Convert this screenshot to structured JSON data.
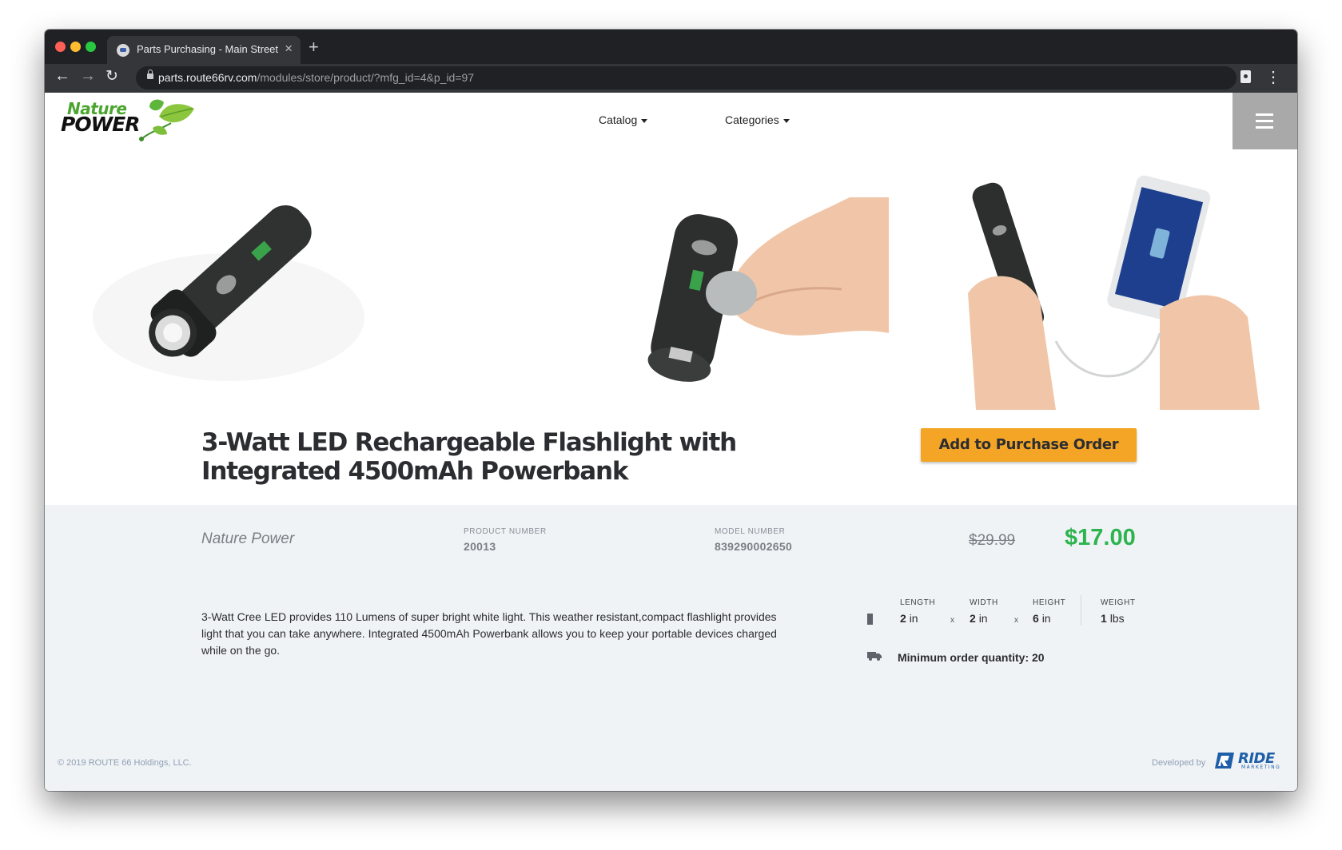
{
  "browser": {
    "tab_title": "Parts Purchasing - Main Street",
    "url_host": "parts.route66rv.com",
    "url_path": "/modules/store/product/?mfg_id=4&p_id=97"
  },
  "header": {
    "logo_line1": "Nature",
    "logo_line2": "POWER",
    "nav": {
      "catalog": "Catalog",
      "categories": "Categories"
    }
  },
  "product": {
    "title": "3-Watt LED Rechargeable Flashlight with Integrated 4500mAh Powerbank",
    "add_button": "Add to Purchase Order",
    "brand": "Nature Power",
    "product_number_label": "PRODUCT NUMBER",
    "product_number": "20013",
    "model_number_label": "MODEL NUMBER",
    "model_number": "839290002650",
    "old_price": "$29.99",
    "price": "$17.00",
    "description": "3-Watt Cree LED provides 110 Lumens of super bright white light. This weather resistant,compact flashlight provides light that you can take anywhere. Integrated 4500mAh Powerbank allows you to keep your portable devices charged while on the go.",
    "dimensions": {
      "length_label": "LENGTH",
      "length_value": "2",
      "length_unit": "in",
      "width_label": "WIDTH",
      "width_value": "2",
      "width_unit": "in",
      "height_label": "HEIGHT",
      "height_value": "6",
      "height_unit": "in",
      "weight_label": "WEIGHT",
      "weight_value": "1",
      "weight_unit": "lbs",
      "x1": "x",
      "x2": "x"
    },
    "min_order": "Minimum order quantity: 20"
  },
  "footer": {
    "copyright": "© 2019 ROUTE 66 Holdings, LLC.",
    "developed_by": "Developed by",
    "dev_logo_text": "RIDE",
    "dev_logo_sub": "MARKETING"
  },
  "colors": {
    "accent_button": "#f4a526",
    "price_green": "#2eb44e",
    "details_bg": "#f0f3f6"
  }
}
